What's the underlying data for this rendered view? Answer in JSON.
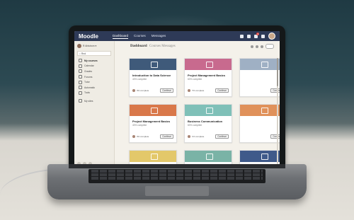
{
  "app": {
    "logo": "Moodle"
  },
  "nav": {
    "items": [
      "Dashboard",
      "Courses",
      "Messages"
    ],
    "active": "Dashboard"
  },
  "topbar": {
    "notification_count": "1"
  },
  "sidebar": {
    "user": "R Ahlstrom ▾",
    "search": "Rnd",
    "items": [
      {
        "label": "My courses",
        "icon": "courses-icon",
        "bold": true
      },
      {
        "label": "Calendar",
        "icon": "calendar-icon"
      },
      {
        "label": "Grades",
        "icon": "grades-icon"
      },
      {
        "label": "Forums",
        "icon": "forums-icon"
      },
      {
        "label": "Tutor",
        "icon": "tutor-icon"
      },
      {
        "label": "Automatic",
        "icon": "automatic-icon"
      },
      {
        "label": "Tools",
        "icon": "tools-icon"
      },
      {
        "label": "My sites",
        "icon": "sites-icon"
      }
    ]
  },
  "main": {
    "breadcrumb": {
      "current": "Dashboard",
      "rest": "Courses  Messages"
    },
    "courses": [
      {
        "title": "Introduction to Data Science",
        "progress": "40% complete",
        "meta": "3% complete",
        "button": "Continue",
        "color": "#3f5a7a"
      },
      {
        "title": "Project Management Basics",
        "progress": "60% complete",
        "meta": "7% complete",
        "button": "Continue",
        "color": "#c86a8e"
      },
      {
        "title": "",
        "progress": "",
        "meta": "",
        "button": "Continue",
        "color": "#9fb0c4"
      },
      {
        "title": "Project Management Basics",
        "progress": "40% complete",
        "meta": "3% complete",
        "button": "Continue",
        "color": "#d9784a"
      },
      {
        "title": "Business Communication",
        "progress": "60% complete",
        "meta": "1% complete",
        "button": "Continue",
        "color": "#7fc0b8"
      },
      {
        "title": "",
        "progress": "",
        "meta": "",
        "button": "Continue",
        "color": "#e0915a"
      },
      {
        "title": "",
        "progress": "",
        "meta": "",
        "button": "",
        "color": "#e3c86a"
      },
      {
        "title": "",
        "progress": "",
        "meta": "",
        "button": "",
        "color": "#7ab3a6"
      },
      {
        "title": "",
        "progress": "",
        "meta": "",
        "button": "",
        "color": "#3f5a8a"
      }
    ]
  }
}
